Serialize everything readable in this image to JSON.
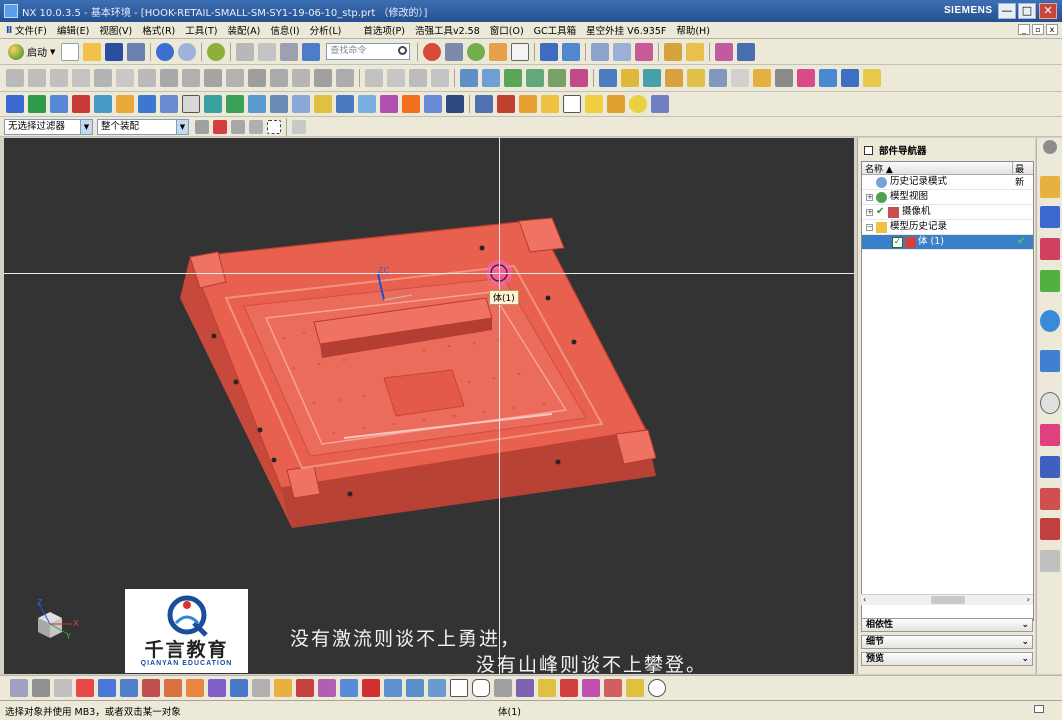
{
  "window": {
    "title": "NX 10.0.3.5 - 基本环境 - [HOOK-RETAIL-SMALL-SM-SY1-19-06-10_stp.prt （修改的）]",
    "brand": "SIEMENS",
    "minimize": "—",
    "maximize": "□",
    "close": "✕"
  },
  "menu": {
    "items": [
      "文件(F)",
      "编辑(E)",
      "视图(V)",
      "格式(R)",
      "工具(T)",
      "装配(A)",
      "信息(I)",
      "分析(L)",
      "首选项(P)",
      "浩强工具v2.58",
      "窗口(O)",
      "GC工具箱",
      "星空外挂 V6.935F",
      "帮助(H)"
    ]
  },
  "toolbar": {
    "start_label": "启动",
    "search_placeholder": "查找命令"
  },
  "selection_bar": {
    "filter": "无选择过滤器",
    "scope": "整个装配"
  },
  "viewport": {
    "tooltip": "体(1)",
    "model_color": "#e8604e",
    "background": "#333333",
    "subtitle_line1": "没有激流则谈不上勇进，",
    "subtitle_line2": "没有山峰则谈不上攀登。",
    "logo_cn": "千言教育",
    "logo_en": "QIANYAN EDUCATION",
    "axis_labels": {
      "zc": "ZC",
      "x": "X",
      "y": "Y",
      "z": "Z"
    }
  },
  "navigator": {
    "title": "部件导航器",
    "col_name": "名称",
    "col_latest": "最新",
    "rows": [
      {
        "label": "历史记录模式"
      },
      {
        "label": "模型视图"
      },
      {
        "label": "摄像机"
      },
      {
        "label": "模型历史记录"
      },
      {
        "label": "体 (1)"
      }
    ],
    "panels": [
      "相依性",
      "细节",
      "预览"
    ]
  },
  "status": {
    "prompt": "选择对象并使用 MB3，或者双击某一对象",
    "selection": "体(1)"
  }
}
